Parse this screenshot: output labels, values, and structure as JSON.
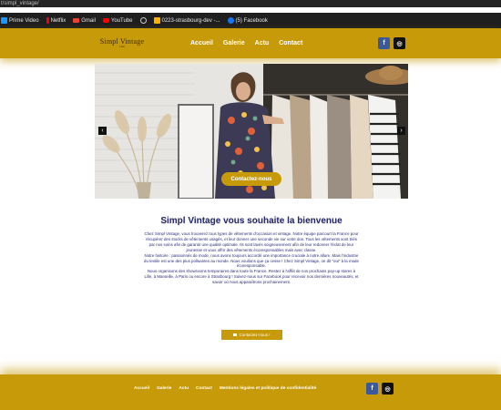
{
  "browser": {
    "url": "t/simpl_vintage/",
    "bookmarks": [
      {
        "label": "Prime Video",
        "icon": "prime-video-icon",
        "color": "#1a98ff"
      },
      {
        "label": "Netflix",
        "icon": "netflix-icon",
        "color": "#e50914"
      },
      {
        "label": "Gmail",
        "icon": "gmail-icon",
        "color": "#ea4335"
      },
      {
        "label": "YouTube",
        "icon": "youtube-icon",
        "color": "#ff0000"
      },
      {
        "label": "",
        "icon": "globe-icon",
        "color": "#cccccc"
      },
      {
        "label": "0223-strasbourg-dev -...",
        "icon": "bookmark-icon",
        "color": "#ffb300"
      },
      {
        "label": "(5) Facebook",
        "icon": "facebook-icon",
        "color": "#1877f2"
      }
    ]
  },
  "header": {
    "logo_main": "Simpl Vintage",
    "logo_sub": "Lille",
    "nav": {
      "accueil": "Accueil",
      "galerie": "Galerie",
      "actu": "Actu",
      "contact": "Contact"
    },
    "facebook_icon": "f",
    "instagram_icon": "◎"
  },
  "hero": {
    "prev_arrow": "‹",
    "next_arrow": "›",
    "cta": "Contactez-nous"
  },
  "main": {
    "title": "Simpl Vintage vous souhaite la bienvenue",
    "intro": "Chez Simpl Vintage, vous trouverez tous types de vêtements d'occasion et vintage. Notre équipe parcourt la France pour récupérer des stocks de vêtements usagés, et leur donner une seconde vie sur votre dos. Tous les vêtements sont triés par nos soins afin de garantir une qualité optimale. Ils sont lavés soigneusement afin de leur redonner l'éclat de leur jeunesse et vous offrir des vêtements écoresponsables mais avec classe.",
    "story": "Notre histoire : passionnés de mode, nous avons toujours accordé une importance cruciale à notre allure. Mais l'industrie du textile est une des plus polluantes au monde. Nous voulions que ça cesse ! Chez Simpl Vintage, on dit \"oui\" à la mode écoresponsable.",
    "events": "Nous organisons des showrooms temporaires dans toute la France. Restez à l'affût de nos prochains pop-up stores à Lille, à Marseille, à Paris ou encore à Strasbourg ! Suivez-nous sur Facebook pour recevoir nos dernières nouveautés, et savoir où nous apparaîtrons prochainement.",
    "cta": "Contactez-nous !"
  },
  "footer": {
    "nav": {
      "accueil": "Accueil",
      "galerie": "Galerie",
      "actu": "Actu",
      "contact": "Contact",
      "legal": "Mentions légales et politique de confidentialité"
    },
    "facebook_icon": "f",
    "instagram_icon": "◎"
  },
  "colors": {
    "gold": "#c79a09",
    "navy": "#27296b",
    "facebook": "#3b5998"
  }
}
